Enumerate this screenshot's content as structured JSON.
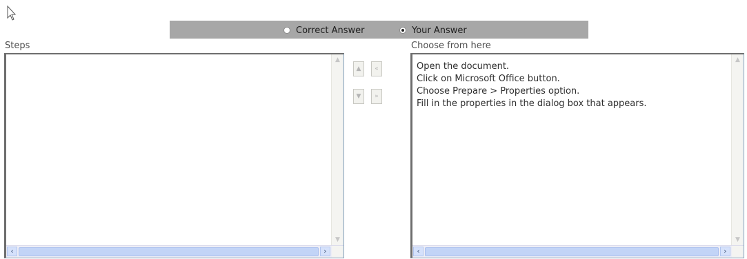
{
  "answer_bar": {
    "options": [
      {
        "label": "Correct Answer",
        "checked": false
      },
      {
        "label": "Your Answer",
        "checked": true
      }
    ]
  },
  "steps": {
    "label": "Steps",
    "items": []
  },
  "choose": {
    "label": "Choose from here",
    "items": [
      "Open the document.",
      "Click on Microsoft Office button.",
      "Choose Prepare > Properties option.",
      "Fill in the properties in the dialog box that appears."
    ]
  },
  "move_buttons": {
    "up": "▲",
    "first": "«",
    "down": "▼",
    "last": "»"
  },
  "icons": {
    "cursor": "mouse-pointer-icon",
    "scroll_left": "‹",
    "scroll_right": "›",
    "scroll_up": "▲",
    "scroll_down": "▼"
  }
}
